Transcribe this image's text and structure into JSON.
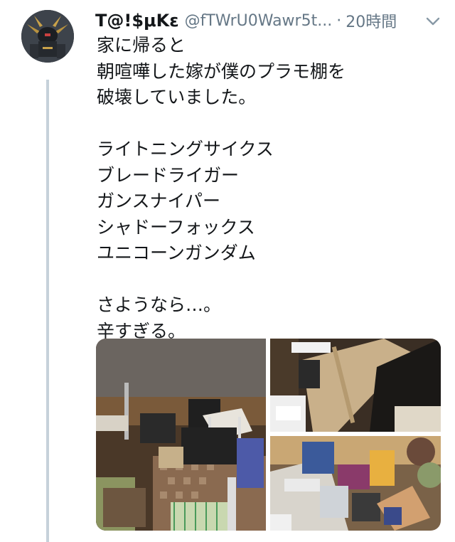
{
  "tweet": {
    "display_name": "T@!$μKε",
    "handle": "@fTWrU0Wawr5t...",
    "separator": "·",
    "timestamp": "20時間",
    "text": "家に帰ると\n朝喧嘩した嫁が僕のプラモ棚を\n破壊していました。\n\nライトニングサイクス\nブレードライガー\nガンスナイパー\nシャドーフォックス\nユニコーンガンダム\n\nさようなら…。\n辛すぎる。",
    "media_count": 3
  },
  "icons": {
    "caret": "chevron-down-icon",
    "avatar": "avatar"
  },
  "colors": {
    "text": "#14171a",
    "secondary": "#657786",
    "thread_line": "#c6d1da"
  }
}
